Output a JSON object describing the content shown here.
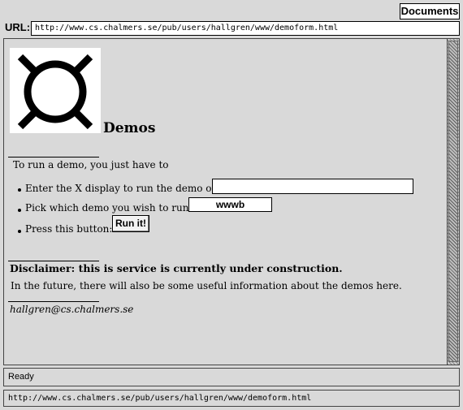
{
  "toolbar": {
    "documents_label": "Documents"
  },
  "address": {
    "label": "URL:",
    "value": "http://www.cs.chalmers.se/pub/users/hallgren/www/demoform.html"
  },
  "page": {
    "logo_icon": "circle-cross-symbol-icon",
    "title": "Demos",
    "intro": "To run a demo, you just have to",
    "steps": [
      {
        "text": "Enter the X display to run the demo on:"
      },
      {
        "text": "Pick which demo you wish to run:"
      },
      {
        "text": "Press this button:"
      }
    ],
    "display_input": {
      "value": ""
    },
    "demo_select": {
      "selected": "wwwb"
    },
    "run_button_label": "Run it!",
    "disclaimer": "Disclaimer: this is service is currently under construction.",
    "future_note": "In the future, there will also be some useful information about the demos here.",
    "contact_email": "hallgren@cs.chalmers.se"
  },
  "status": {
    "message": "Ready",
    "link_url": "http://www.cs.chalmers.se/pub/users/hallgren/www/demoform.html"
  },
  "colors": {
    "background": "#d9d9d9",
    "field_background": "#ffffff",
    "text": "#000000"
  }
}
